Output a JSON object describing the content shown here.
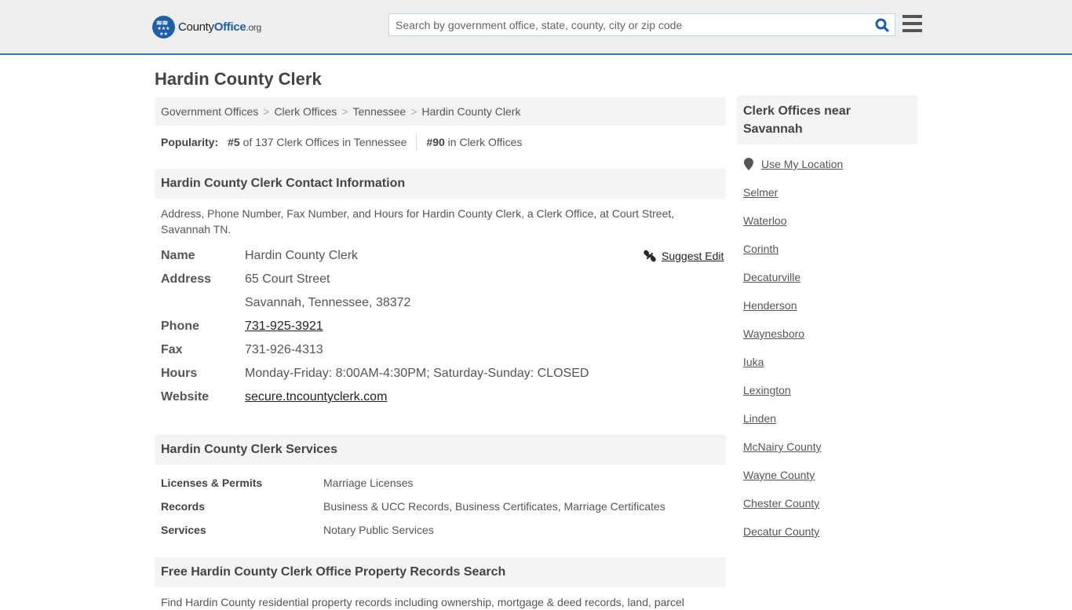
{
  "header": {
    "logo": {
      "name": "County",
      "accent": "Office",
      "tld": ".org"
    },
    "search": {
      "placeholder": "Search by government office, state, county, city or zip code",
      "value": ""
    },
    "brand_color": "#1f5fa8",
    "border_color": "#3a7bb0"
  },
  "page": {
    "title": "Hardin County Clerk"
  },
  "breadcrumb": [
    "Government Offices",
    "Clerk Offices",
    "Tennessee",
    "Hardin County Clerk"
  ],
  "popularity": {
    "label": "Popularity:",
    "state_rank": "#5",
    "state_text": "of 137 Clerk Offices in Tennessee",
    "national_rank": "#90",
    "national_text": "in Clerk Offices"
  },
  "contact": {
    "heading": "Hardin County Clerk Contact Information",
    "description": "Address, Phone Number, Fax Number, and Hours for Hardin County Clerk, a Clerk Office, at Court Street, Savannah TN.",
    "suggest_edit": "Suggest Edit",
    "rows": {
      "name": {
        "label": "Name",
        "value": "Hardin County Clerk"
      },
      "address": {
        "label": "Address",
        "line1": "65 Court Street",
        "line2": "Savannah, Tennessee, 38372"
      },
      "phone": {
        "label": "Phone",
        "value": "731-925-3921"
      },
      "fax": {
        "label": "Fax",
        "value": "731-926-4313"
      },
      "hours": {
        "label": "Hours",
        "value": "Monday-Friday: 8:00AM-4:30PM; Saturday-Sunday: CLOSED"
      },
      "website": {
        "label": "Website",
        "value": "secure.tncountyclerk.com"
      }
    }
  },
  "services": {
    "heading": "Hardin County Clerk Services",
    "rows": [
      {
        "label": "Licenses & Permits",
        "value": "Marriage Licenses"
      },
      {
        "label": "Records",
        "value": "Business & UCC Records, Business Certificates, Marriage Certificates"
      },
      {
        "label": "Services",
        "value": "Notary Public Services"
      }
    ]
  },
  "property": {
    "heading": "Free Hardin County Clerk Office Property Records Search",
    "description": "Find Hardin County residential property records including ownership, mortgage & deed records, land, parcel"
  },
  "sidebar": {
    "heading": "Clerk Offices near Savannah",
    "use_location": "Use My Location",
    "links": [
      "Selmer",
      "Waterloo",
      "Corinth",
      "Decaturville",
      "Henderson",
      "Waynesboro",
      "Iuka",
      "Lexington",
      "Linden",
      "McNairy County",
      "Wayne County",
      "Chester County",
      "Decatur County"
    ]
  }
}
